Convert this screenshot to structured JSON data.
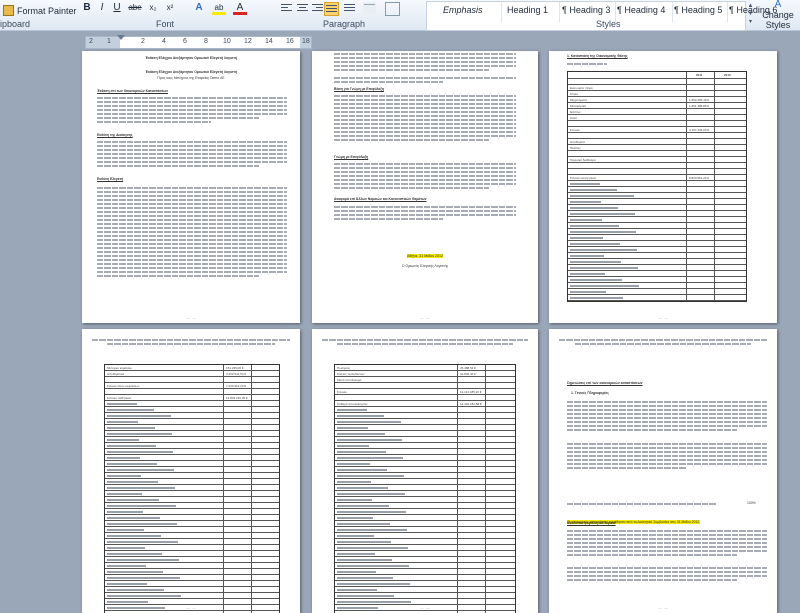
{
  "ribbon": {
    "format_painter": "Format Painter",
    "clipboard_label": "ipboard",
    "font_label": "Font",
    "paragraph_label": "Paragraph",
    "styles_label": "Styles",
    "bold": "B",
    "italic": "I",
    "underline": "U",
    "strike": "abe",
    "subscript": "x₂",
    "superscript": "x²",
    "text_effects": "A",
    "highlight": "ab",
    "font_color": "A",
    "styles": [
      "Emphasis",
      "Heading 1",
      "¶ Heading 3",
      "¶ Heading 4",
      "¶ Heading 5",
      "¶ Heading 6"
    ],
    "change_styles": "Change Styles"
  },
  "ruler": {
    "ticks": [
      "2",
      "1",
      "2",
      "4",
      "6",
      "8",
      "10",
      "12",
      "14",
      "16",
      "18"
    ]
  },
  "pages": {
    "p1": {
      "title1": "Έκθεση Ελέγχου Ανεξάρτητου Ορκωτού Ελεγκτή Λογιστή",
      "title2": "Προς τους Μετόχους της Εταιρείας Demo ΑΕ",
      "sec1": "Έκθεση επί των Οικονομικών Καταστάσεων",
      "sec2": "Ευθύνη της Διοίκησης",
      "sec3": "Ευθύνη Ελεγκτή"
    },
    "p2": {
      "sec1": "Βάση για Γνώμη με Επιφύλαξη",
      "sec2": "Γνώμη με Επιφύλαξη",
      "sec3": "Αναφορά επί Άλλων Νομικών και Κανονιστικών Θεμάτων",
      "date": "Αθήνα, 31 Μαΐου 2012",
      "sign": "Ο Ορκωτός Ελεγκτής Λογιστής"
    },
    "p3": {
      "title": "1.  Κατάσταση της Οικονομικής Θέσης",
      "col1": "2011",
      "col2": "2010",
      "rows": [
        {
          "label": "",
          "v1": "",
          "v2": ""
        },
        {
          "label": "Ενσώματα πάγια",
          "v1": "",
          "v2": ""
        },
        {
          "label": "Κτίρια",
          "v1": "",
          "v2": ""
        },
        {
          "label": "Μηχανήματα",
          "v1": "1.553.465,49 €",
          "v2": ""
        },
        {
          "label": "Μεταφορικά",
          "v1": "1.651.486,88 €",
          "v2": ""
        },
        {
          "label": "Έπιπλα",
          "v1": "",
          "v2": ""
        },
        {
          "label": "Άυλα",
          "v1": "",
          "v2": ""
        },
        {
          "label": "",
          "v1": "",
          "v2": ""
        },
        {
          "label": "Σύνολο",
          "v1": "4.157.233,00 €",
          "v2": ""
        },
        {
          "label": "",
          "v1": "",
          "v2": ""
        },
        {
          "label": "Αποθέματα",
          "v1": "",
          "v2": ""
        },
        {
          "label": "Πελάτες",
          "v1": "",
          "v2": ""
        },
        {
          "label": "",
          "v1": "",
          "v2": ""
        },
        {
          "label": "Ταμειακά διαθέσιμα",
          "v1": "",
          "v2": ""
        },
        {
          "label": "",
          "v1": "",
          "v2": ""
        },
        {
          "label": "",
          "v1": "",
          "v2": ""
        },
        {
          "label": "Σύνολο ενεργητικού",
          "v1": "8.833.861,20 €",
          "v2": ""
        }
      ]
    },
    "p4": {
      "rows": [
        {
          "label": "Μετοχικό κεφάλαιο",
          "v1": "154.235,00 €",
          "v2": ""
        },
        {
          "label": "Αποθεματικά",
          "v1": "3.462.541,54 €",
          "v2": ""
        },
        {
          "label": "",
          "v1": "",
          "v2": ""
        },
        {
          "label": "Σύνολο ιδίων κεφαλαίων",
          "v1": "7.233.912,23 €",
          "v2": ""
        },
        {
          "label": "",
          "v1": "",
          "v2": ""
        },
        {
          "label": "Σύνολο παθητικού",
          "v1": "13.833.160,05 €",
          "v2": ""
        }
      ]
    },
    "p5": {
      "rows": [
        {
          "label": "Πωλήσεις",
          "v1": "45.488,54 €",
          "v2": ""
        },
        {
          "label": "Κόστος πωληθέντων",
          "v1": "42.845,46 €",
          "v2": ""
        },
        {
          "label": "Μικτό αποτέλεσμα",
          "v1": "",
          "v2": ""
        },
        {
          "label": "",
          "v1": "",
          "v2": ""
        },
        {
          "label": "Σύνολο",
          "v1": "12.113.185,20 €",
          "v2": ""
        },
        {
          "label": "",
          "v1": "",
          "v2": ""
        },
        {
          "label": "Καθαρά αποτελέσματα",
          "v1": "14.432.182,58 €",
          "v2": ""
        }
      ]
    },
    "p6": {
      "title": "Σημειώσεις επί των οικονομικών καταστάσεων",
      "sec1": "1.   Γενικές Πληροφορίες",
      "pct": "100%",
      "highlight": "Οι οικονομικές καταστάσεις εγκρίθηκαν από το Διοικητικό Συμβούλιο στις 31 Μαΐου 2012.",
      "sec2": "Αναλυτικά φορολογικά θέματα"
    }
  }
}
